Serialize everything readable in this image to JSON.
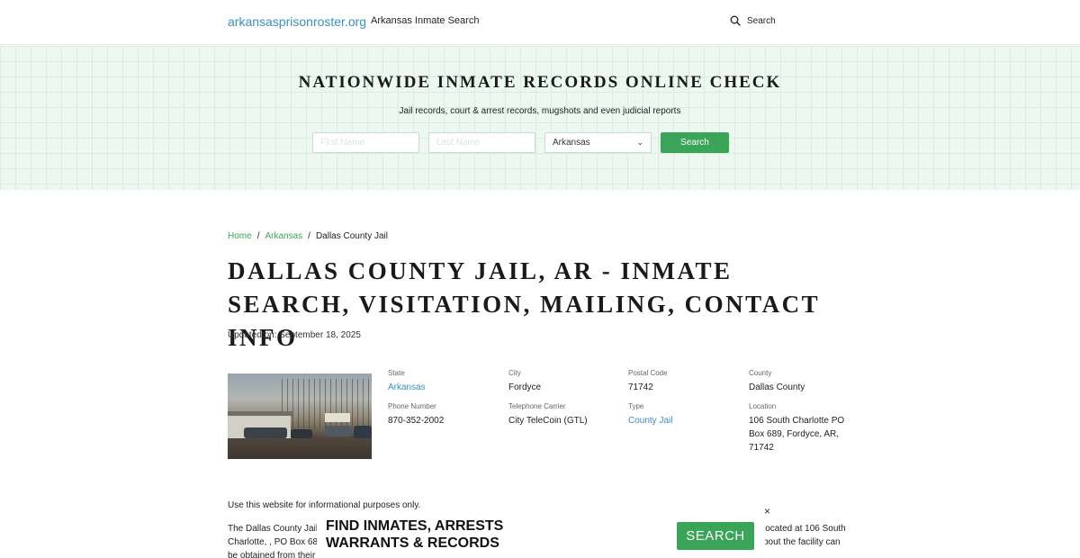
{
  "header": {
    "site_name": "arkansasprisonroster.org",
    "nav_link": "Arkansas Inmate Search",
    "search_label": "Search"
  },
  "hero": {
    "title": "NATIONWIDE INMATE RECORDS ONLINE CHECK",
    "subtitle": "Jail records, court & arrest records, mugshots and even judicial reports",
    "first_name_placeholder": "First Name",
    "last_name_placeholder": "Last Name",
    "state_selected": "Arkansas",
    "search_button": "Search"
  },
  "breadcrumb": {
    "home": "Home",
    "sep1": "/",
    "state": "Arkansas",
    "sep2": "/",
    "current": "Dallas County Jail"
  },
  "page": {
    "title": "DALLAS COUNTY JAIL, AR - INMATE SEARCH, VISITATION, MAILING, CONTACT INFO",
    "updated": "Updated on: September 18, 2025"
  },
  "facility": {
    "state_label": "State",
    "state_value": "Arkansas",
    "city_label": "City",
    "city_value": "Fordyce",
    "postal_label": "Postal Code",
    "postal_value": "71742",
    "county_label": "County",
    "county_value": "Dallas County",
    "phone_label": "Phone Number",
    "phone_value": "870-352-2002",
    "carrier_label": "Telephone Carrier",
    "carrier_value": "City TeleCoin (GTL)",
    "type_label": "Type",
    "type_value": "County Jail",
    "location_label": "Location",
    "location_value": "106 South Charlotte PO Box 689, Fordyce, AR, 71742"
  },
  "content": {
    "disclaimer": "Use this website for informational purposes only.",
    "para_left_1": "The Dallas County Jail",
    "para_left_2": "Charlotte, , PO Box 68",
    "para_left_3": "be obtained from their",
    "para_right_1": "located at 106 South",
    "para_right_2": "bout the facility can"
  },
  "ad": {
    "title_line1": "FIND INMATES, ARRESTS",
    "title_line2": "WARRANTS & RECORDS",
    "button": "SEARCH",
    "close": "×"
  },
  "colors": {
    "brand_link": "#3a8fc7",
    "accent_green": "#3aa558",
    "hero_bg": "#ecf8f0"
  },
  "icons": {
    "search": "search-icon",
    "close": "close-icon",
    "select_arrow": "chevron-down-icon"
  }
}
